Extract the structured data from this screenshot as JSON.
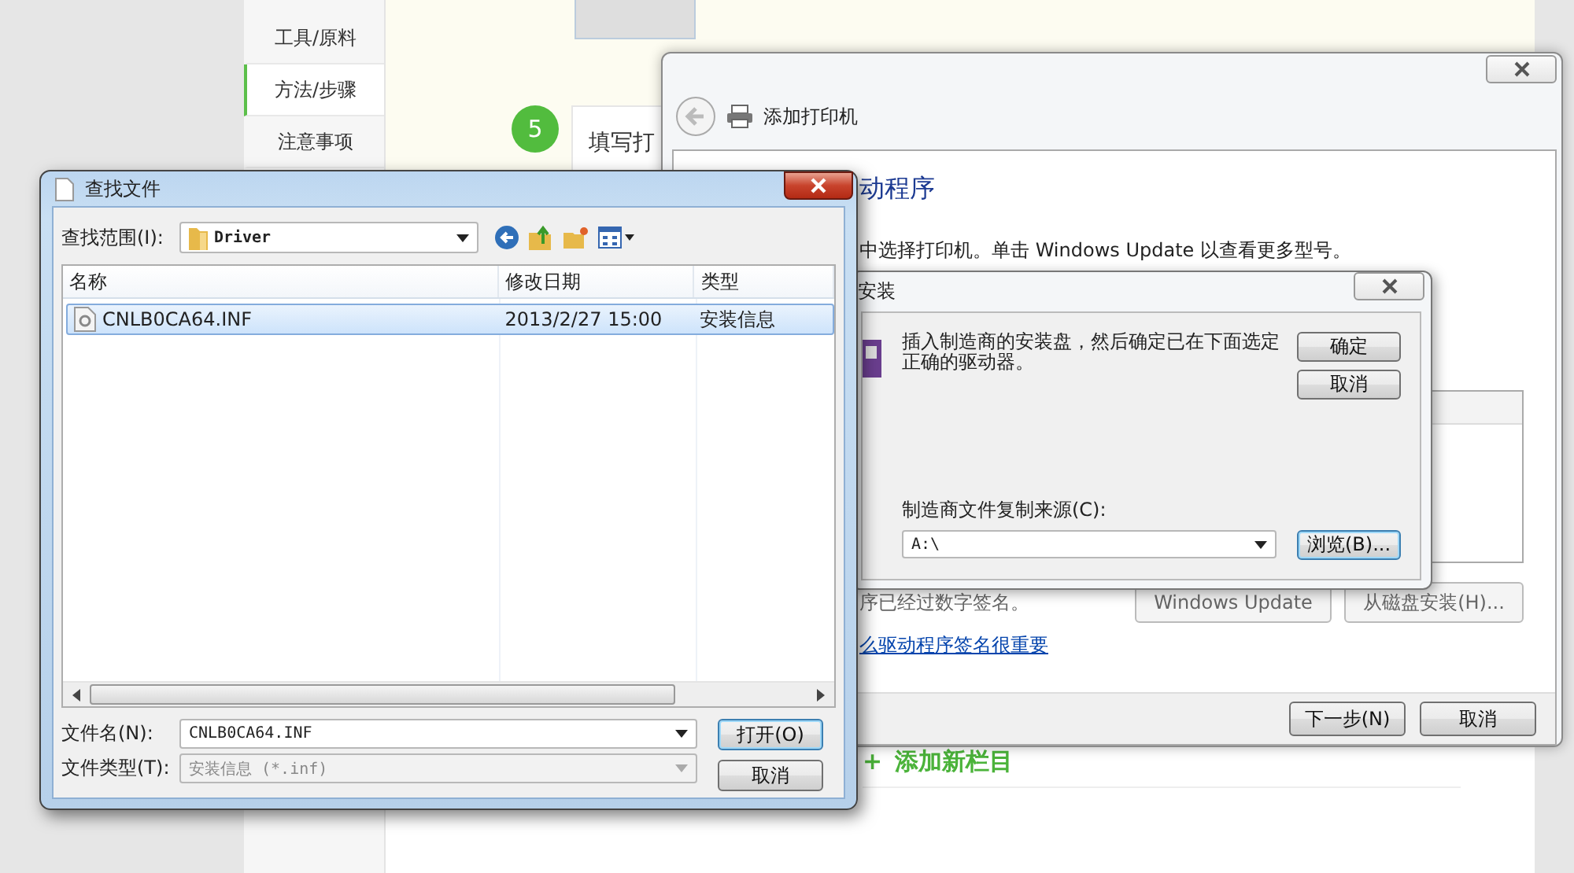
{
  "sidebar": {
    "items": [
      {
        "label": "工具/原料",
        "selected": false
      },
      {
        "label": "方法/步骤",
        "selected": true
      },
      {
        "label": "注意事项",
        "selected": false
      }
    ]
  },
  "step": {
    "number": "5",
    "title": "填写打"
  },
  "add_section": {
    "icon": "+",
    "label": "添加新栏目"
  },
  "add_printer": {
    "title": "添加打印机",
    "heading": "动程序",
    "instruction": "中选择打印机。单击 Windows Update 以查看更多型号。",
    "signature_note": "序已经过数字签名。",
    "buttons": [
      "Windows Update",
      "从磁盘安装(H)..."
    ],
    "link": "么驱动程序签名很重要",
    "footer_buttons": [
      "下一步(N)",
      "取消"
    ]
  },
  "install_disk": {
    "title": "安装",
    "message": "插入制造商的安装盘，然后确定已在下面选定正确的驱动器。",
    "buttons": [
      "确定",
      "取消"
    ],
    "source_label": "制造商文件复制来源(C):",
    "source_value": "A:\\",
    "browse": "浏览(B)..."
  },
  "find_file": {
    "title": "查找文件",
    "look_in_label": "查找范围(I):",
    "look_in_value": "Driver",
    "columns": [
      "名称",
      "修改日期",
      "类型"
    ],
    "rows": [
      {
        "cells": [
          "CNLB0CA64.INF",
          "2013/2/27 15:00",
          "安装信息"
        ],
        "selected": true
      }
    ],
    "filename_label": "文件名(N):",
    "filename_value": "CNLB0CA64.INF",
    "filetype_label": "文件类型(T):",
    "filetype_value": "安装信息 (*.inf)",
    "filetype_disabled": true,
    "buttons": [
      "打开(O)",
      "取消"
    ]
  }
}
